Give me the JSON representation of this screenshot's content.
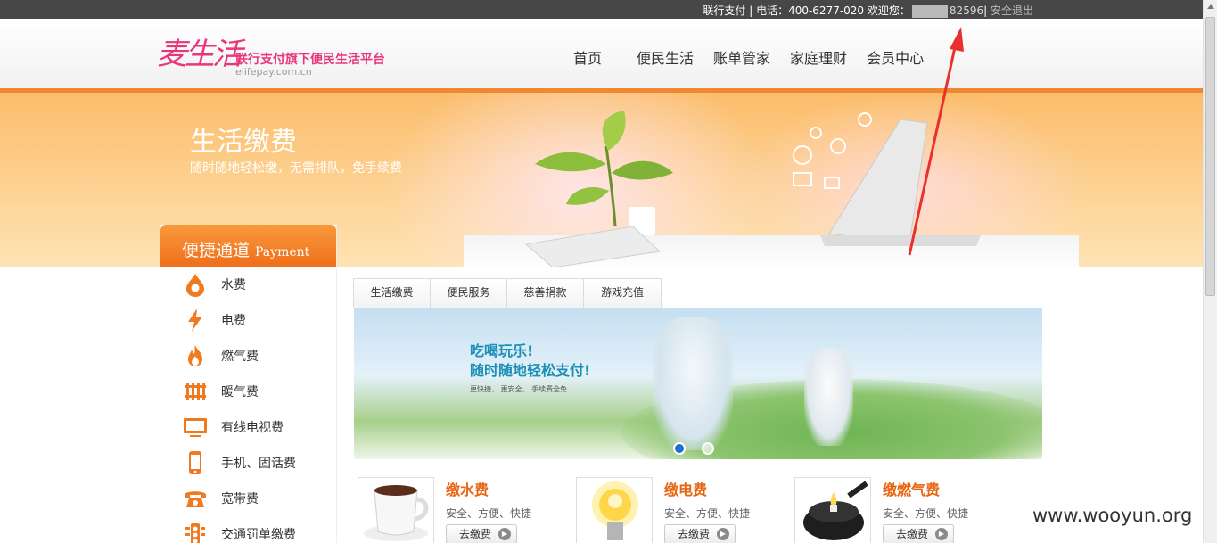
{
  "topbar": {
    "company": "联行支付",
    "separator": "|",
    "phone_text": "电话：400-6277-020",
    "welcome": "欢迎您：",
    "masked_suffix": "82596",
    "separator2": "|",
    "logout": "安全退出"
  },
  "logo": {
    "mark": "麦生活",
    "slogan": "联行支付旗下便民生活平台",
    "domain": "elifepay.com.cn"
  },
  "nav": {
    "items": [
      "首页",
      "便民生活",
      "账单管家",
      "家庭理财",
      "会员中心"
    ]
  },
  "banner": {
    "title": "生活缴费",
    "subtitle": "随时随地轻松缴，无需排队，免手续费"
  },
  "sidebar": {
    "title_zh": "便捷通道",
    "title_en": "Payment",
    "items": [
      {
        "label": "水费",
        "icon": "water-drop-icon"
      },
      {
        "label": "电费",
        "icon": "lightning-icon"
      },
      {
        "label": "燃气费",
        "icon": "flame-icon"
      },
      {
        "label": "暖气费",
        "icon": "radiator-icon"
      },
      {
        "label": "有线电视费",
        "icon": "tv-icon"
      },
      {
        "label": "手机、固话费",
        "icon": "mobile-phone-icon"
      },
      {
        "label": "宽带费",
        "icon": "telephone-icon"
      },
      {
        "label": "交通罚单缴费",
        "icon": "traffic-light-icon"
      }
    ]
  },
  "tabs": [
    "生活缴费",
    "便民服务",
    "慈善捐款",
    "游戏充值"
  ],
  "carousel": {
    "line1": "吃喝玩乐!",
    "line2": "随时随地轻松支付!",
    "note": "更快捷、 更安全、 手续费全免",
    "active_slide": 1,
    "slide_count": 2
  },
  "products": [
    {
      "name": "缴水费",
      "desc": "安全、方便、快捷",
      "button": "去缴费"
    },
    {
      "name": "缴电费",
      "desc": "安全、方便、快捷",
      "button": "去缴费"
    },
    {
      "name": "缴燃气费",
      "desc": "安全、方便、快捷",
      "button": "去缴费"
    }
  ],
  "watermark": "www.wooyun.org",
  "colors": {
    "accent": "#f08732",
    "brand_pink": "#e8367a",
    "product_title": "#e96412",
    "annotation_arrow": "#e8302f"
  }
}
